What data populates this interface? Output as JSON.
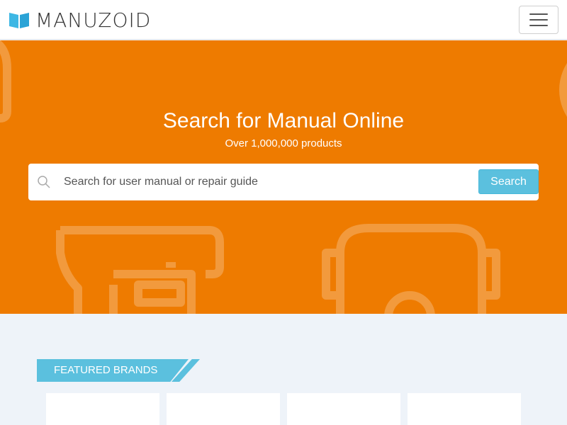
{
  "header": {
    "logo_text": "MANUZOID",
    "logo_icon": "open-book-icon",
    "menu_icon": "hamburger-icon"
  },
  "hero": {
    "title": "Search for Manual Online",
    "subtitle": "Over 1,000,000 products",
    "background_color": "#ee7b00"
  },
  "search": {
    "icon": "search-icon",
    "placeholder": "Search for user manual or repair guide",
    "value": "",
    "button_label": "Search",
    "button_color": "#5bc0de"
  },
  "featured": {
    "label": "FEATURED BRANDS",
    "cards": 4
  },
  "colors": {
    "accent": "#5bc0de",
    "brand_orange": "#ee7b00",
    "page_bg": "#eef3f9"
  }
}
